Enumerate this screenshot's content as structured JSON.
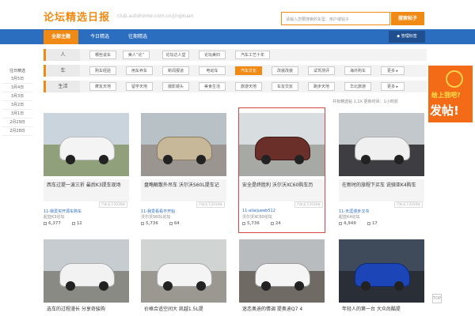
{
  "header": {
    "logo": "论坛精选日报",
    "logo_sub": "club.autohome.com.cn/jingxuan",
    "search_placeholder": "请输入您要搜索的车型、用户或帖子",
    "search_button": "搜索帖子"
  },
  "nav": {
    "tabs": [
      "全部主题",
      "今日精选",
      "往期精选"
    ],
    "right": "◆ 管理标签"
  },
  "filter": {
    "rows": [
      {
        "label": "人",
        "tags": [
          "哪些说车",
          "美人“论”",
          "论坛达人堂",
          "论坛美妇",
          "汽车工艺十年"
        ]
      },
      {
        "label": "车",
        "tags": [
          "购车经验",
          "用车养车",
          "新闻报道",
          "电动车",
          "汽车文化",
          "改装改装",
          "试驾测评",
          "海外购车",
          "更多 ▸"
        ],
        "active": 4
      },
      {
        "label": "生活",
        "tags": [
          "摩友天地",
          "留学天地",
          "摄影镜头",
          "美食生活",
          "旅游天地",
          "车友交友",
          "跑步天地",
          "华北旅游",
          "更多 ▸"
        ]
      }
    ]
  },
  "sidebar": {
    "title": "往日精选",
    "dates": [
      "3月5日",
      "3月4日",
      "3月3日",
      "3月2日",
      "3月1日",
      "2月29日",
      "2月28日"
    ]
  },
  "info": "共有精选帖 1,1X 更新时间：1小时前",
  "ad": {
    "line1": "给上我吧?",
    "line2": "发帖!"
  },
  "cards": [
    {
      "caption": "西车过提一波三折 最后K3提车现场",
      "stamp": "汽车天下2016年",
      "user": "11-我爱买开源车购车",
      "brand": "起亚K3论坛",
      "views": "6,377",
      "replies": "12",
      "highlight": false
    },
    {
      "caption": "盘略解散外吊车 沃尔沃S60L提车记",
      "stamp": "汽车天下2016年",
      "user": "11-我爱看看不开始",
      "brand": "沃尔沃S60L论坛",
      "views": "5,736",
      "replies": "64",
      "highlight": false
    },
    {
      "caption": "安全是终胜利 沃尔沃XC60购车历",
      "stamp": "汽车天下2016年",
      "user": "11-ailaijueeb512",
      "brand": "沃尔沃XC60论坛",
      "views": "5,736",
      "replies": "24",
      "highlight": true
    },
    {
      "caption": "在新时的旅程下买车 说骑亚K4购车",
      "stamp": "汽车天下2016年",
      "user": "11-天涯漫步汉书",
      "brand": "起亚K4论坛",
      "views": "4,949",
      "replies": "17",
      "highlight": false
    }
  ],
  "cards2": [
    {
      "caption": "选车的过程漫长 分享奇骏购"
    },
    {
      "caption": "价格合适空间大 凯越1.5L提"
    },
    {
      "caption": "迷恋奥迪的情调 提奥迪Q7 4"
    },
    {
      "caption": "年轻人的第一台 大众尚酷提"
    }
  ],
  "top_button": "TOP"
}
